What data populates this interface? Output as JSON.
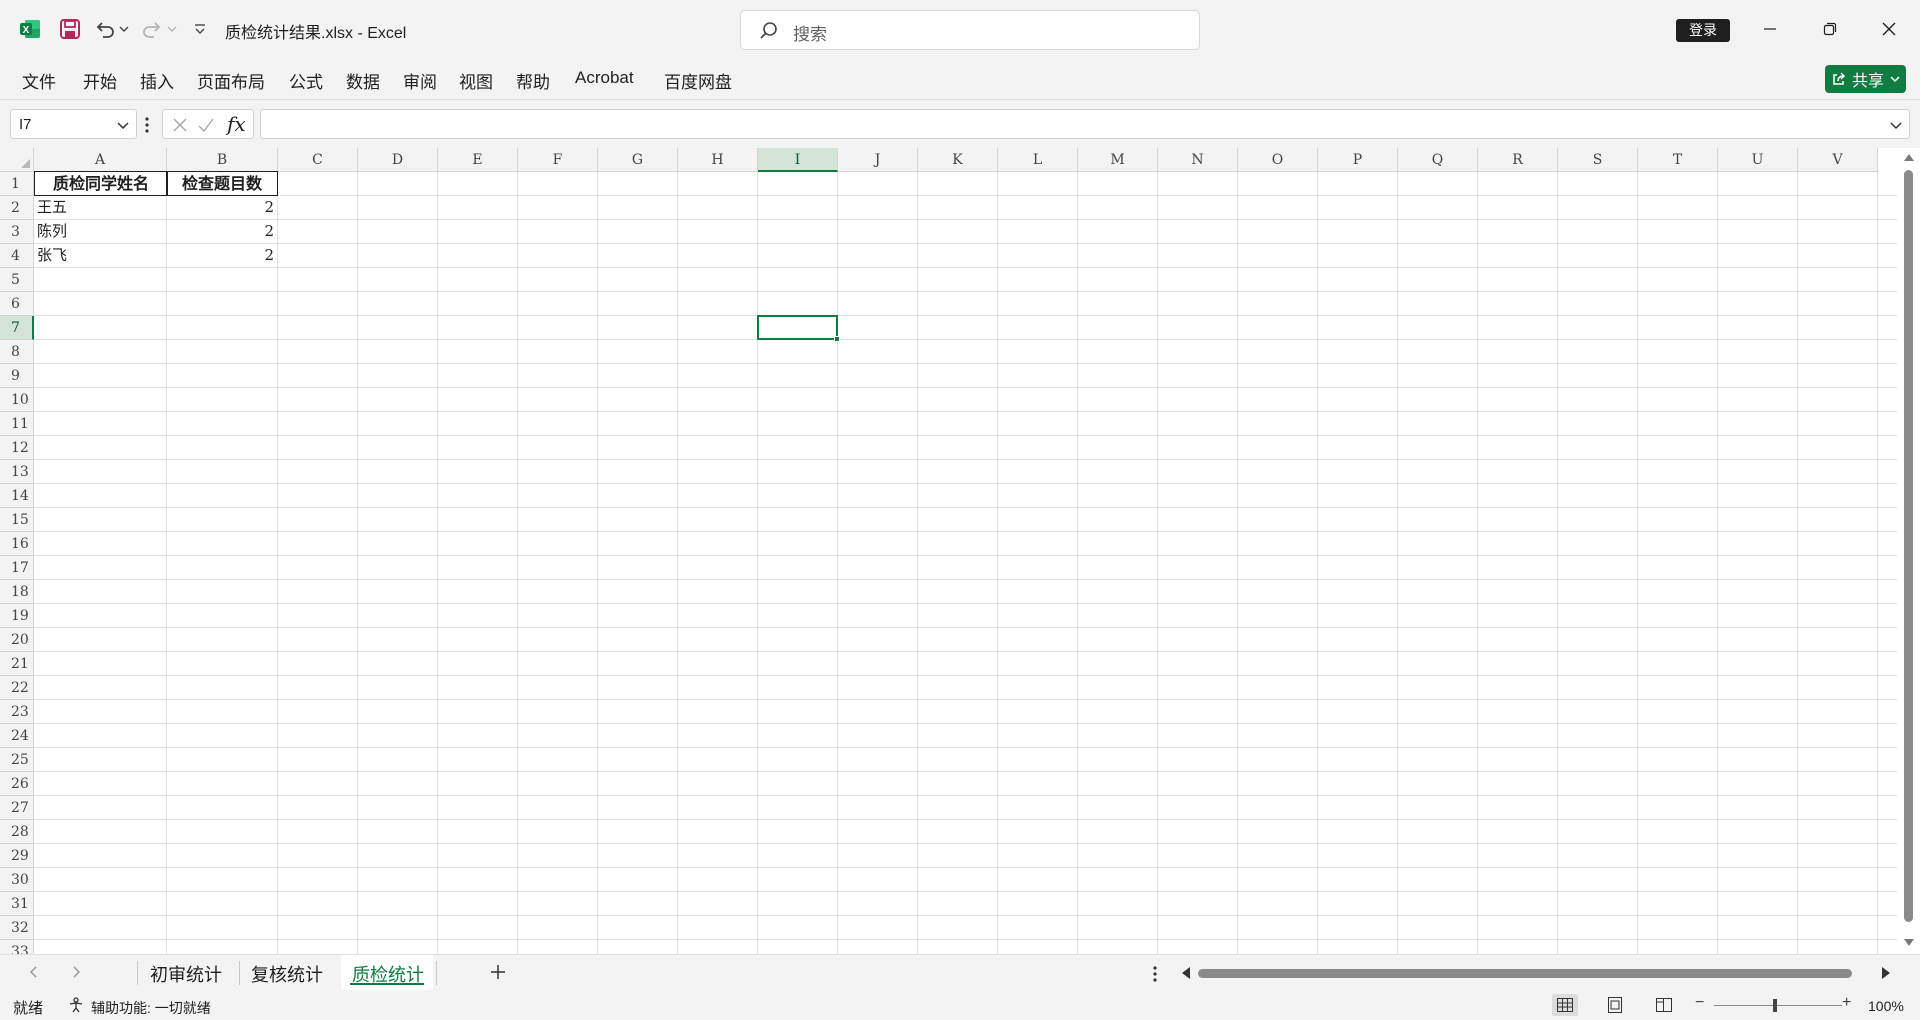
{
  "titlebar": {
    "document_title": "质检统计结果.xlsx  -  Excel",
    "search_placeholder": "搜索",
    "signin_label": "登录"
  },
  "ribbon": {
    "tabs": [
      "文件",
      "开始",
      "插入",
      "页面布局",
      "公式",
      "数据",
      "审阅",
      "视图",
      "帮助",
      "Acrobat",
      "百度网盘"
    ],
    "share_label": "共享"
  },
  "formula_bar": {
    "name_box": "I7",
    "fx_label": "fx",
    "formula": ""
  },
  "grid": {
    "columns": [
      "A",
      "B",
      "C",
      "D",
      "E",
      "F",
      "G",
      "H",
      "I",
      "J",
      "K",
      "L",
      "M",
      "N",
      "O",
      "P",
      "Q",
      "R",
      "S",
      "T",
      "U",
      "V"
    ],
    "rows": [
      "1",
      "2",
      "3",
      "4",
      "5",
      "6",
      "7",
      "8",
      "9",
      "10",
      "11",
      "12",
      "13",
      "14",
      "15",
      "16",
      "17",
      "18",
      "19",
      "20",
      "21",
      "22",
      "23",
      "24",
      "25",
      "26",
      "27",
      "28",
      "29",
      "30",
      "31",
      "32",
      "33"
    ],
    "selected_column": "I",
    "selected_row": "7",
    "cells": {
      "A1": "质检同学姓名",
      "B1": "检查题目数",
      "A2": "王五",
      "B2": "2",
      "A3": "陈列",
      "B3": "2",
      "A4": "张飞",
      "B4": "2"
    }
  },
  "sheets": {
    "tabs": [
      "初审统计",
      "复核统计",
      "质检统计"
    ],
    "active": "质检统计"
  },
  "statusbar": {
    "ready": "就绪",
    "accessibility": "辅助功能: 一切就绪",
    "zoom": "100%"
  },
  "colors": {
    "accent": "#107c41",
    "chrome": "#f3f3f3",
    "gridline": "#e1e1e1"
  }
}
